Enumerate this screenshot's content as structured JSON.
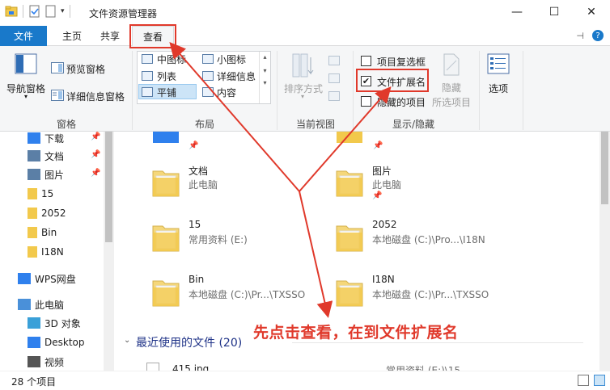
{
  "window": {
    "title": "文件资源管理器",
    "controls": {
      "minimize": "—",
      "maximize": "☐",
      "close": "✕"
    }
  },
  "tabs": {
    "file": "文件",
    "home": "主页",
    "share": "共享",
    "view": "查看"
  },
  "ribbon": {
    "panes": {
      "nav_pane": "导航窗格",
      "preview_pane": "预览窗格",
      "details_pane": "详细信息窗格",
      "group_label": "窗格"
    },
    "layout": {
      "medium_icons": "中图标",
      "small_icons": "小图标",
      "list": "列表",
      "details": "详细信息",
      "tiles": "平铺",
      "content": "内容",
      "group_label": "布局"
    },
    "current_view": {
      "sort_by": "排序方式",
      "group_label": "当前视图"
    },
    "show_hide": {
      "item_checkboxes": "项目复选框",
      "item_checkboxes_checked": false,
      "file_extensions": "文件扩展名",
      "file_extensions_checked": true,
      "hidden_items": "隐藏的项目",
      "hidden_items_checked": false,
      "hide_selected_line1": "隐藏",
      "hide_selected_line2": "所选项目",
      "group_label": "显示/隐藏"
    },
    "options": "选项"
  },
  "nav_pane": {
    "items": [
      {
        "label": "下载",
        "icon": "download-icon",
        "pinned": true
      },
      {
        "label": "文档",
        "icon": "document-icon",
        "pinned": true
      },
      {
        "label": "图片",
        "icon": "picture-icon",
        "pinned": true
      },
      {
        "label": "15",
        "icon": "folder-icon",
        "pinned": false
      },
      {
        "label": "2052",
        "icon": "folder-icon",
        "pinned": false
      },
      {
        "label": "Bin",
        "icon": "folder-icon",
        "pinned": false
      },
      {
        "label": "I18N",
        "icon": "folder-icon",
        "pinned": false
      },
      {
        "label": "WPS网盘",
        "icon": "cloud-icon",
        "pinned": false
      },
      {
        "label": "此电脑",
        "icon": "computer-icon",
        "pinned": false
      },
      {
        "label": "3D 对象",
        "icon": "cube-icon",
        "pinned": false
      },
      {
        "label": "Desktop",
        "icon": "desktop-icon",
        "pinned": false
      },
      {
        "label": "视频",
        "icon": "video-icon",
        "pinned": false
      }
    ]
  },
  "content": {
    "tiles": [
      {
        "name": "文档",
        "sub": "此电脑",
        "pinned": false
      },
      {
        "name": "图片",
        "sub": "此电脑",
        "pinned": true
      },
      {
        "name": "15",
        "sub": "常用资料 (E:)",
        "pinned": false
      },
      {
        "name": "2052",
        "sub": "本地磁盘 (C:)\\Pro...\\I18N",
        "pinned": false
      },
      {
        "name": "Bin",
        "sub": "本地磁盘 (C:)\\Pr...\\TXSSO",
        "pinned": false
      },
      {
        "name": "I18N",
        "sub": "本地磁盘 (C:)\\Pr...\\TXSSO",
        "pinned": false
      }
    ],
    "recent_header": "最近使用的文件 (20)",
    "recent_first": {
      "name": "415.jpg",
      "location": "常用资料 (E:)\\15"
    }
  },
  "status": {
    "item_count": "28 个项目"
  },
  "annotation": {
    "note": "先点击查看，在到文件扩展名",
    "color": "#e0392b"
  }
}
